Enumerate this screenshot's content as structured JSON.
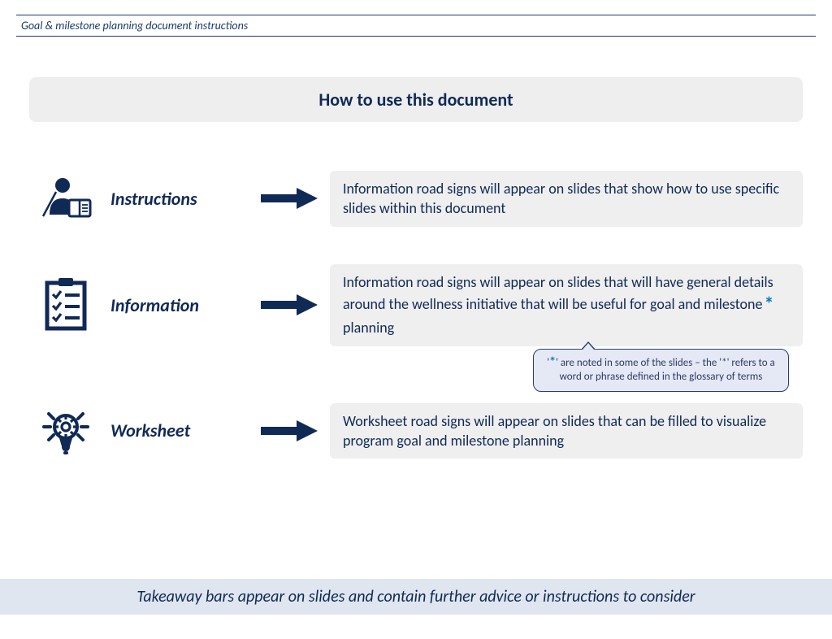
{
  "header": {
    "label": "Goal & milestone planning document instructions"
  },
  "title": "How to use this document",
  "rows": [
    {
      "label": "Instructions",
      "desc": "Information road signs will appear on slides that show how to use specific slides within this document"
    },
    {
      "label": "Information",
      "desc_pre": "Information road signs will appear on slides that will have general details around the wellness initiative that will be useful for goal and milestone",
      "desc_post": " planning"
    },
    {
      "label": "Worksheet",
      "desc": "Worksheet road signs will appear on slides that can be filled to visualize program goal and milestone planning"
    }
  ],
  "callout": {
    "star": "*",
    "text_pre": "'",
    "text_post": "' are noted in some of the slides – the '*' refers to a word or phrase defined in the glossary of terms"
  },
  "footer": "Takeaway bars appear on slides and contain further advice or instructions to consider"
}
